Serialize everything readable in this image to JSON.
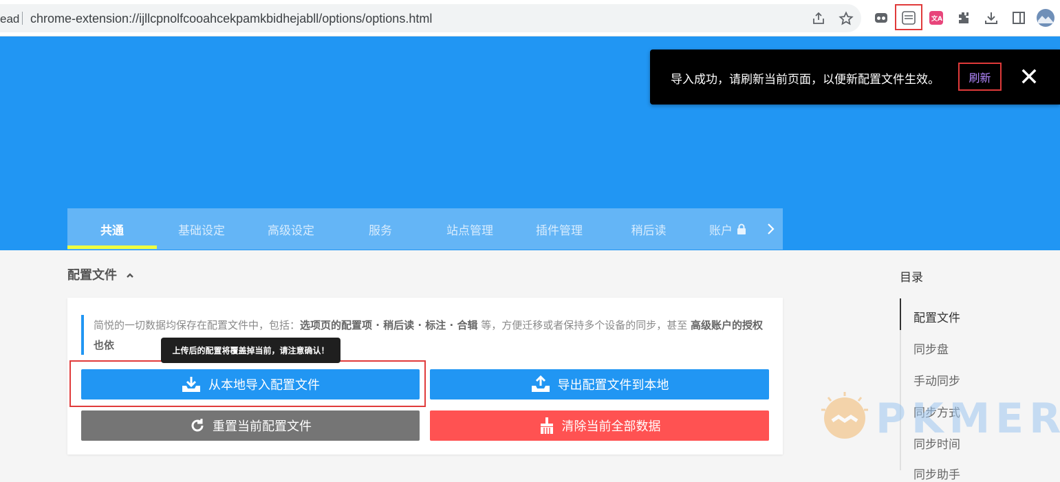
{
  "browser": {
    "prefix": "ead",
    "url": "chrome-extension://ijllcpnolfcooahcekpamkbidhejabll/options/options.html"
  },
  "toast": {
    "message": "导入成功，请刷新当前页面，以便新配置文件生效。",
    "action": "刷新"
  },
  "tabs": [
    {
      "label": "共通",
      "active": true
    },
    {
      "label": "基础设定"
    },
    {
      "label": "高级设定"
    },
    {
      "label": "服务"
    },
    {
      "label": "站点管理"
    },
    {
      "label": "插件管理"
    },
    {
      "label": "稍后读"
    },
    {
      "label": "账户"
    }
  ],
  "section": {
    "title": "配置文件",
    "desc_pre": "简悦的一切数据均保存在配置文件中，包括：",
    "desc_bold1": "选项页的配置项 · 稍后读 · 标注 · 合辑",
    "desc_mid": " 等，方便迁移或者保持多个设备的同步，甚至 ",
    "desc_bold2": "高级账户的授权也依",
    "tooltip": "上传后的配置将覆盖掉当前，请注意确认！",
    "buttons": {
      "import": "从本地导入配置文件",
      "export": "导出配置文件到本地",
      "reset": "重置当前配置文件",
      "clear": "清除当前全部数据"
    }
  },
  "toc": {
    "title": "目录",
    "items": [
      "配置文件",
      "同步盘",
      "手动同步",
      "同步方式",
      "同步时间",
      "同步助手"
    ]
  },
  "watermark": "PKMER",
  "colors": {
    "primary": "#2196f3",
    "tabs_bg": "#64b5f6",
    "indicator": "#eeff41",
    "reset": "#757575",
    "danger": "#ff5252"
  }
}
